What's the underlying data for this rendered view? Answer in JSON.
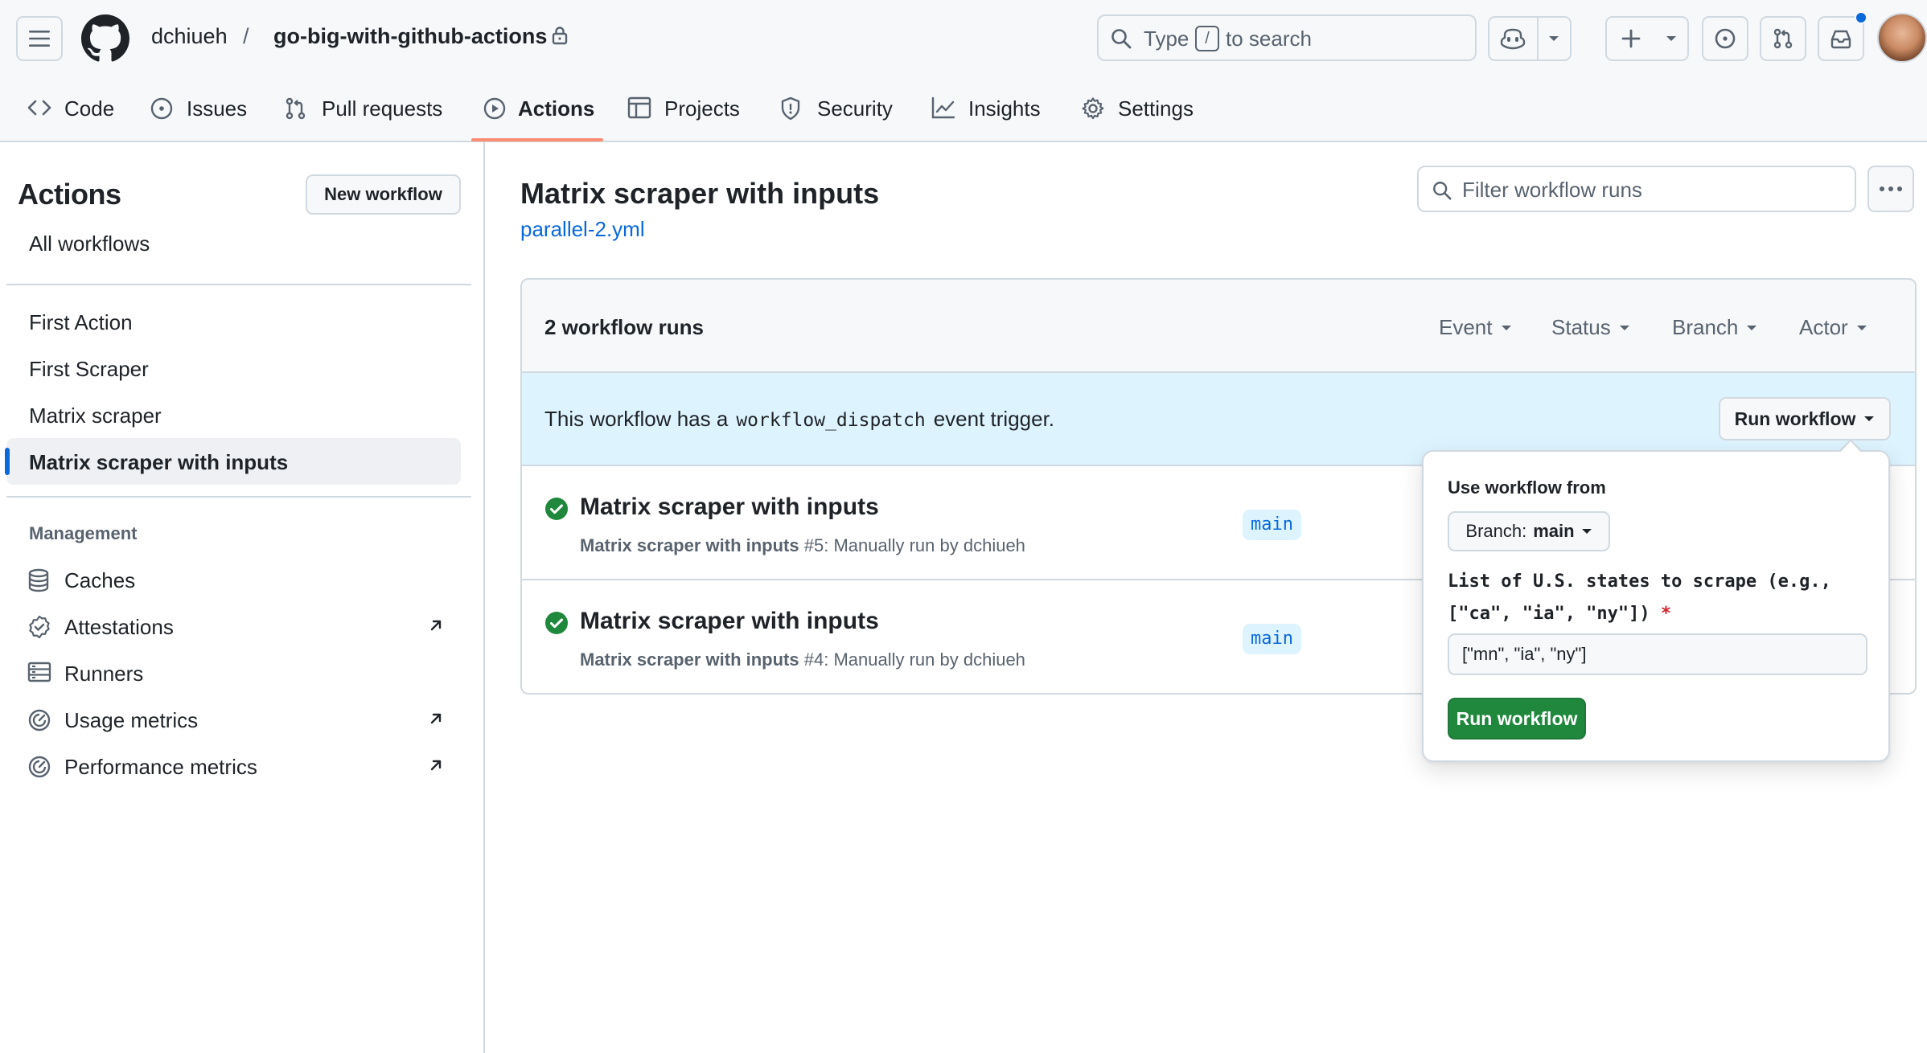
{
  "header": {
    "owner": "dchiueh",
    "separator": "/",
    "repo": "go-big-with-github-actions",
    "search": {
      "prefix": "Type",
      "key": "/",
      "suffix": "to search"
    }
  },
  "tabs": [
    {
      "label": "Code",
      "icon": "code-icon"
    },
    {
      "label": "Issues",
      "icon": "issue-opened-icon"
    },
    {
      "label": "Pull requests",
      "icon": "git-pull-request-icon"
    },
    {
      "label": "Actions",
      "icon": "play-icon",
      "active": true
    },
    {
      "label": "Projects",
      "icon": "table-icon"
    },
    {
      "label": "Security",
      "icon": "shield-icon"
    },
    {
      "label": "Insights",
      "icon": "graph-icon"
    },
    {
      "label": "Settings",
      "icon": "gear-icon"
    }
  ],
  "sidebar": {
    "title": "Actions",
    "new_workflow": "New workflow",
    "all_workflows": "All workflows",
    "workflows": [
      {
        "label": "First Action"
      },
      {
        "label": "First Scraper"
      },
      {
        "label": "Matrix scraper"
      },
      {
        "label": "Matrix scraper with inputs",
        "selected": true
      }
    ],
    "management_heading": "Management",
    "management": [
      {
        "label": "Caches",
        "icon": "database-icon",
        "external": false
      },
      {
        "label": "Attestations",
        "icon": "verified-icon",
        "external": true
      },
      {
        "label": "Runners",
        "icon": "server-icon",
        "external": false
      },
      {
        "label": "Usage metrics",
        "icon": "meter-icon",
        "external": true
      },
      {
        "label": "Performance metrics",
        "icon": "meter-icon",
        "external": true
      }
    ]
  },
  "main": {
    "title": "Matrix scraper with inputs",
    "file": "parallel-2.yml",
    "filter_placeholder": "Filter workflow runs",
    "runs_count": "2 workflow runs",
    "filters": [
      "Event",
      "Status",
      "Branch",
      "Actor"
    ],
    "dispatch": {
      "prefix": "This workflow has a",
      "code": "workflow_dispatch",
      "suffix": "event trigger.",
      "button": "Run workflow"
    },
    "runs": [
      {
        "title": "Matrix scraper with inputs",
        "name": "Matrix scraper with inputs",
        "detail": "#5: Manually run by dchiueh",
        "branch": "main",
        "status": "success"
      },
      {
        "title": "Matrix scraper with inputs",
        "name": "Matrix scraper with inputs",
        "detail": "#4: Manually run by dchiueh",
        "branch": "main",
        "status": "success"
      }
    ]
  },
  "popover": {
    "heading": "Use workflow from",
    "branch_label": "Branch:",
    "branch_value": "main",
    "input_label": "List of U.S. states to scrape (e.g., [\"ca\", \"ia\", \"ny\"])",
    "required_mark": "*",
    "input_value": "[\"mn\", \"ia\", \"ny\"]",
    "submit": "Run workflow"
  },
  "colors": {
    "accent": "#0969da",
    "success": "#1f883d",
    "tab_underline": "#fd8c73",
    "dispatch_bg": "#ddf4ff"
  }
}
